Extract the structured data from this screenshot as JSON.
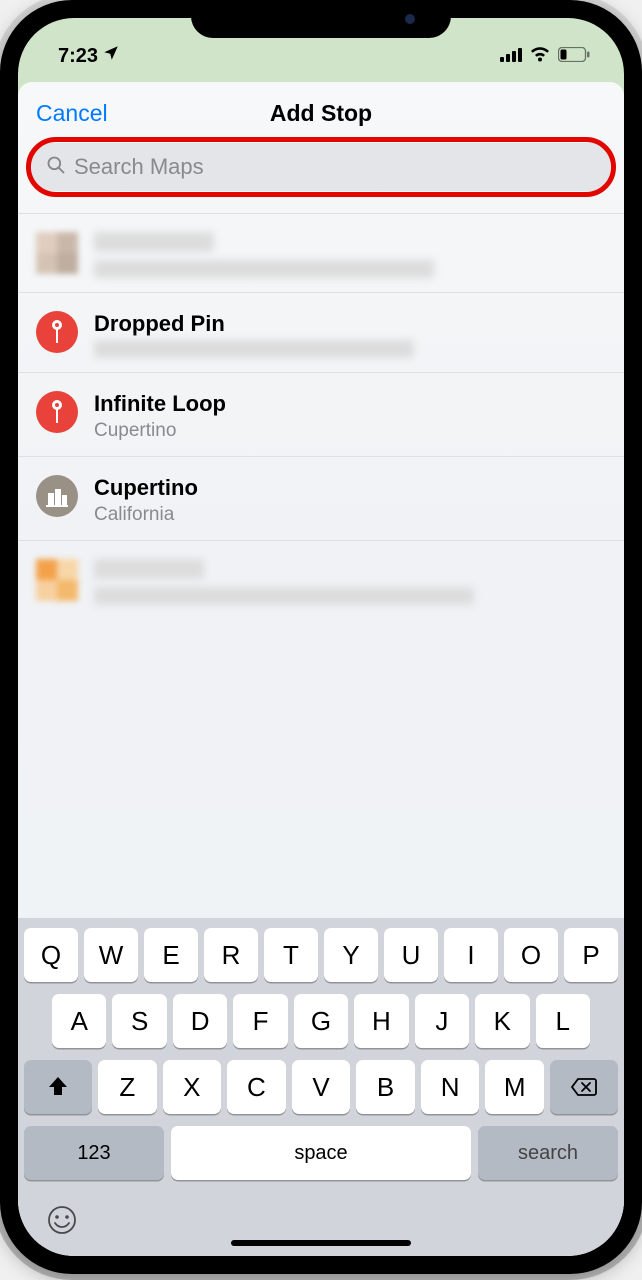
{
  "status": {
    "time": "7:23",
    "location_icon": "location",
    "signal_bars": 4,
    "wifi": 3,
    "battery_low": true
  },
  "header": {
    "cancel": "Cancel",
    "title": "Add Stop"
  },
  "search": {
    "placeholder": "Search Maps",
    "value": ""
  },
  "results": {
    "r0": {
      "title_redacted": true,
      "sub_redacted": true
    },
    "r1": {
      "title": "Dropped Pin",
      "sub_redacted": true,
      "icon": "pin"
    },
    "r2": {
      "title": "Infinite Loop",
      "sub": "Cupertino",
      "icon": "pin"
    },
    "r3": {
      "title": "Cupertino",
      "sub": "California",
      "icon": "city"
    },
    "r4": {
      "title_redacted": true,
      "sub_redacted": true
    }
  },
  "keyboard": {
    "row1": [
      "Q",
      "W",
      "E",
      "R",
      "T",
      "Y",
      "U",
      "I",
      "O",
      "P"
    ],
    "row2": [
      "A",
      "S",
      "D",
      "F",
      "G",
      "H",
      "J",
      "K",
      "L"
    ],
    "row3": [
      "Z",
      "X",
      "C",
      "V",
      "B",
      "N",
      "M"
    ],
    "numbers": "123",
    "space": "space",
    "action": "search"
  }
}
